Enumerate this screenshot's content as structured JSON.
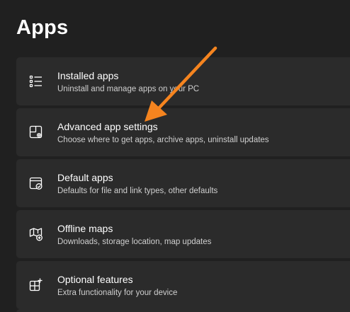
{
  "page": {
    "title": "Apps"
  },
  "items": [
    {
      "title": "Installed apps",
      "subtitle": "Uninstall and manage apps on your PC",
      "icon": "list-icon"
    },
    {
      "title": "Advanced app settings",
      "subtitle": "Choose where to get apps, archive apps, uninstall updates",
      "icon": "apps-settings-icon"
    },
    {
      "title": "Default apps",
      "subtitle": "Defaults for file and link types, other defaults",
      "icon": "default-apps-icon"
    },
    {
      "title": "Offline maps",
      "subtitle": "Downloads, storage location, map updates",
      "icon": "offline-map-icon"
    },
    {
      "title": "Optional features",
      "subtitle": "Extra functionality for your device",
      "icon": "add-apps-icon"
    }
  ],
  "colors": {
    "background": "#202020",
    "card": "#2b2b2b",
    "annotation_arrow": "#f5841f"
  }
}
